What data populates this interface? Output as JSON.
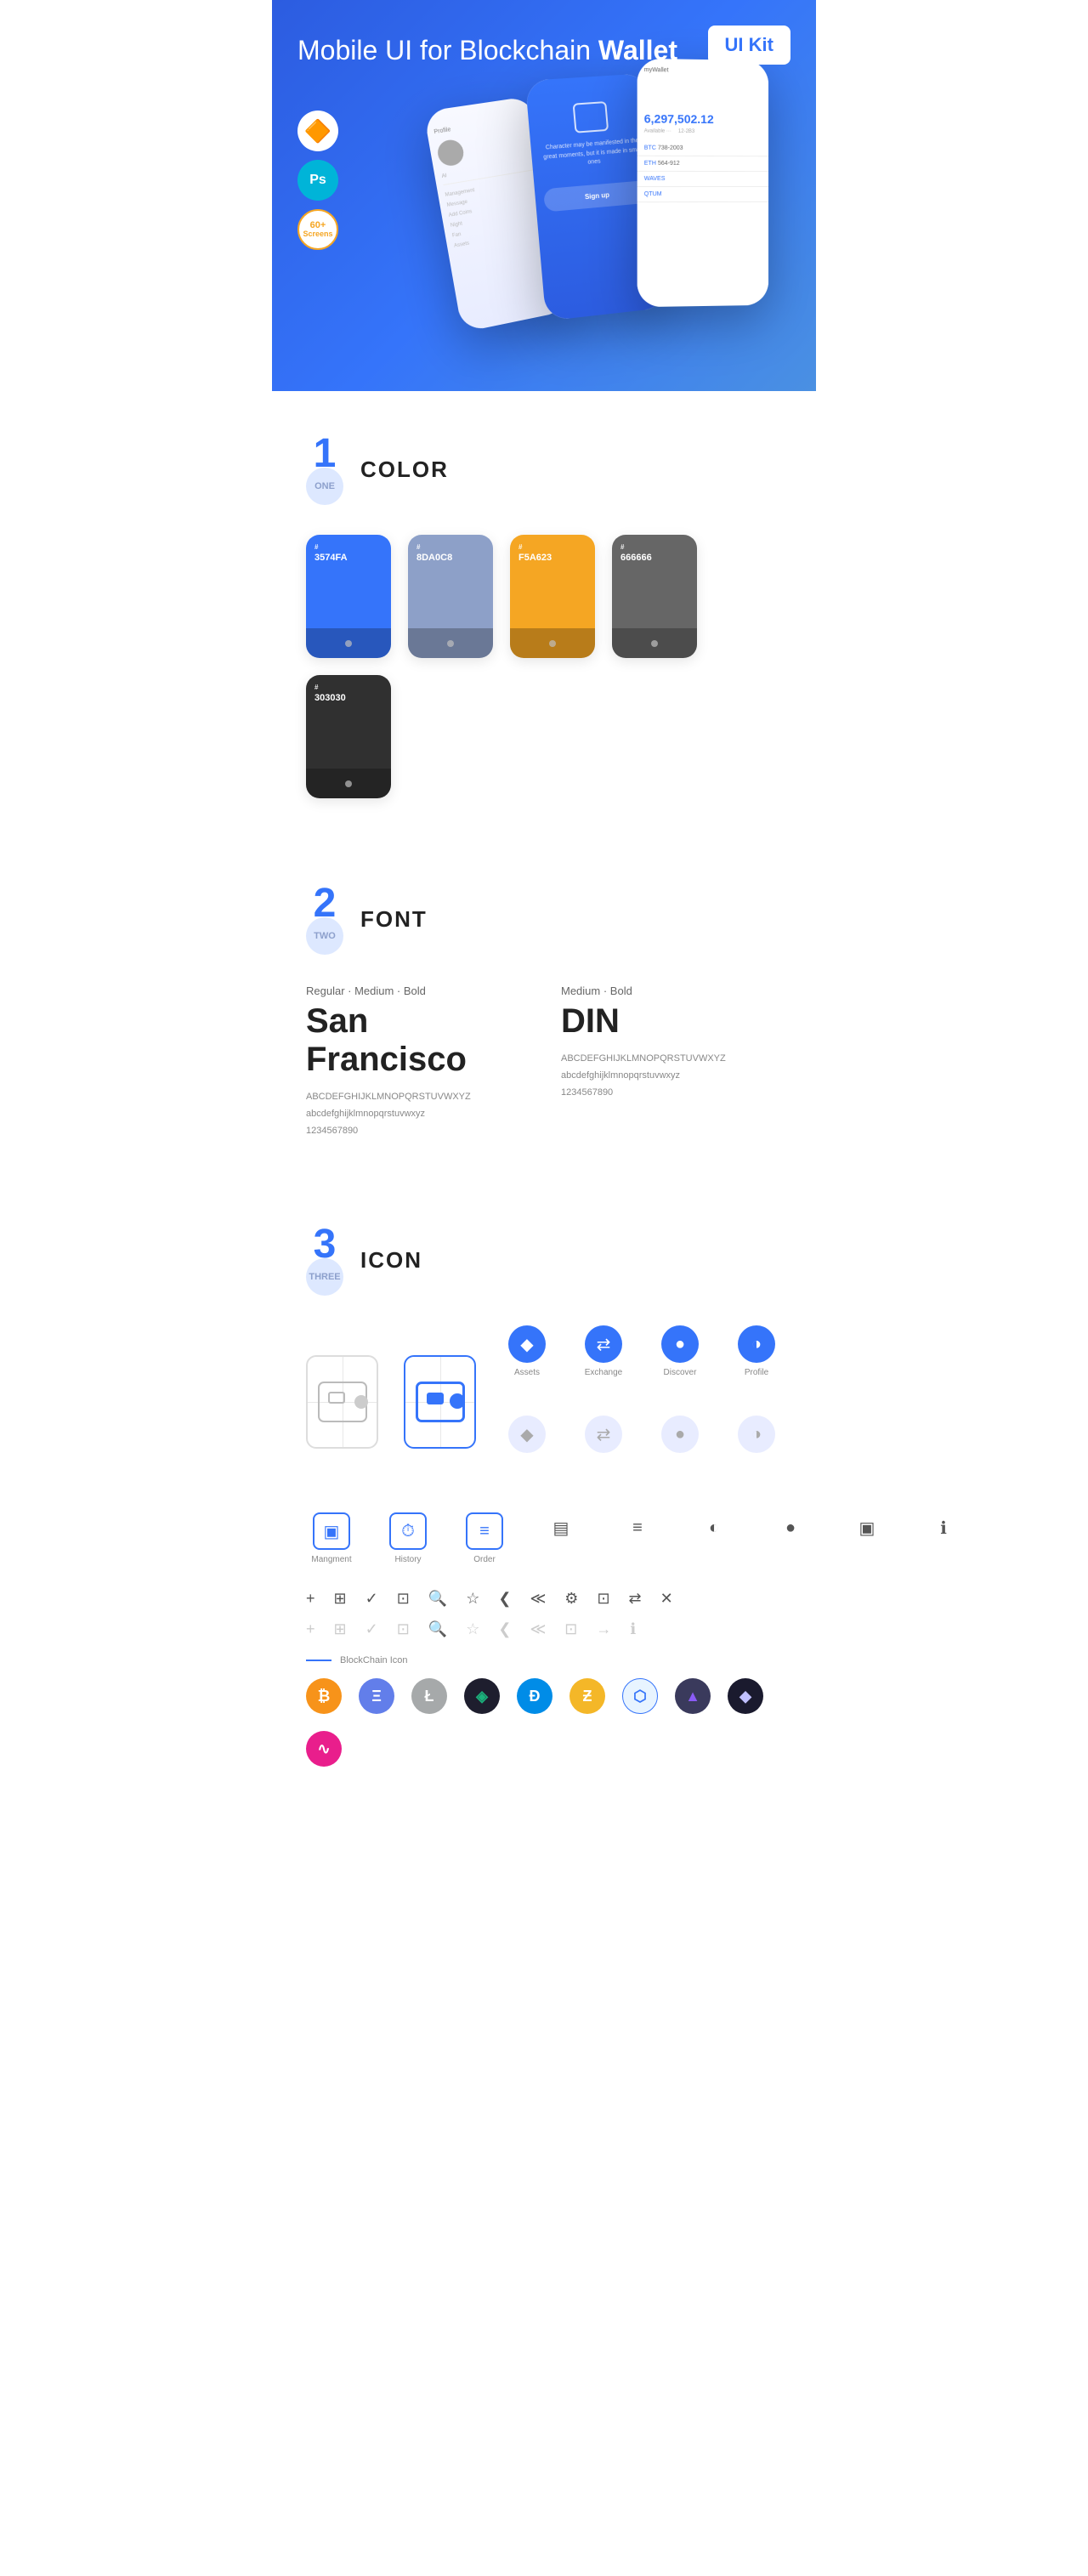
{
  "hero": {
    "title_regular": "Mobile UI for Blockchain ",
    "title_bold": "Wallet",
    "badge": "UI Kit",
    "badges": {
      "sketch": "✦",
      "ps": "Ps",
      "screens": "60+\nScreens"
    }
  },
  "sections": {
    "color": {
      "number": "1",
      "word": "ONE",
      "title": "COLOR",
      "swatches": [
        {
          "hex": "#",
          "code": "3574FA",
          "bg": "#3574FA"
        },
        {
          "hex": "#",
          "code": "8DA0C8",
          "bg": "#8DA0C8"
        },
        {
          "hex": "#",
          "code": "F5A623",
          "bg": "#F5A623"
        },
        {
          "hex": "#",
          "code": "666666",
          "bg": "#666666"
        },
        {
          "hex": "#",
          "code": "303030",
          "bg": "#303030"
        }
      ]
    },
    "font": {
      "number": "2",
      "word": "TWO",
      "title": "FONT",
      "fonts": [
        {
          "label": "Regular · Medium · Bold",
          "name": "San Francisco",
          "uppercase": "ABCDEFGHIJKLMNOPQRSTUVWXYZ",
          "lowercase": "abcdefghijklmnopqrstuvwxyz",
          "numbers": "1234567890"
        },
        {
          "label": "Medium · Bold",
          "name": "DIN",
          "uppercase": "ABCDEFGHIJKLMNOPQRSTUVWXYZ",
          "lowercase": "abcdefghijklmnopqrstuvwxyz",
          "numbers": "1234567890"
        }
      ]
    },
    "icon": {
      "number": "3",
      "word": "THREE",
      "title": "ICON",
      "nav_icons": [
        {
          "label": "Assets",
          "icon": "◆"
        },
        {
          "label": "Exchange",
          "icon": "⇌"
        },
        {
          "label": "Discover",
          "icon": "⊙"
        },
        {
          "label": "Profile",
          "icon": "◑"
        }
      ],
      "nav_icons_gray": [
        {
          "icon": "◆"
        },
        {
          "icon": "⇌"
        },
        {
          "icon": "⊙"
        },
        {
          "icon": "◑"
        }
      ],
      "bottom_icons": [
        {
          "label": "Mangment",
          "icon": "▣"
        },
        {
          "label": "History",
          "icon": "⏱"
        },
        {
          "label": "Order",
          "icon": "≡"
        }
      ],
      "misc_icons_dark": [
        "+",
        "⊞",
        "✓",
        "⊡",
        "🔍",
        "☆",
        "❮",
        "≪",
        "⚙",
        "⊡",
        "⇄",
        "✕"
      ],
      "misc_icons_gray": [
        "+",
        "⊞",
        "✓",
        "⊡",
        "🔍",
        "☆",
        "❮",
        "≪",
        "⊡",
        "→",
        "ℹ"
      ],
      "blockchain_label": "BlockChain Icon",
      "crypto_icons": [
        {
          "symbol": "₿",
          "bg": "#f7931a",
          "color": "#fff"
        },
        {
          "symbol": "Ξ",
          "bg": "#627eea",
          "color": "#fff"
        },
        {
          "symbol": "Ł",
          "bg": "#a6a9aa",
          "color": "#fff"
        },
        {
          "symbol": "▲",
          "bg": "#1e1e2e",
          "color": "#1bb27c"
        },
        {
          "symbol": "D",
          "bg": "#008ce7",
          "color": "#fff"
        },
        {
          "symbol": "Z",
          "bg": "#f4b728",
          "color": "#fff"
        },
        {
          "symbol": "✦",
          "bg": "#e8f0ff",
          "color": "#3574fa"
        },
        {
          "symbol": "▲",
          "bg": "#3a3a5c",
          "color": "#8b5cf6"
        },
        {
          "symbol": "◆",
          "bg": "#1a1a2e",
          "color": "#c0c0ff"
        },
        {
          "symbol": "~",
          "bg": "#e91e8c",
          "color": "#fff"
        }
      ]
    }
  }
}
